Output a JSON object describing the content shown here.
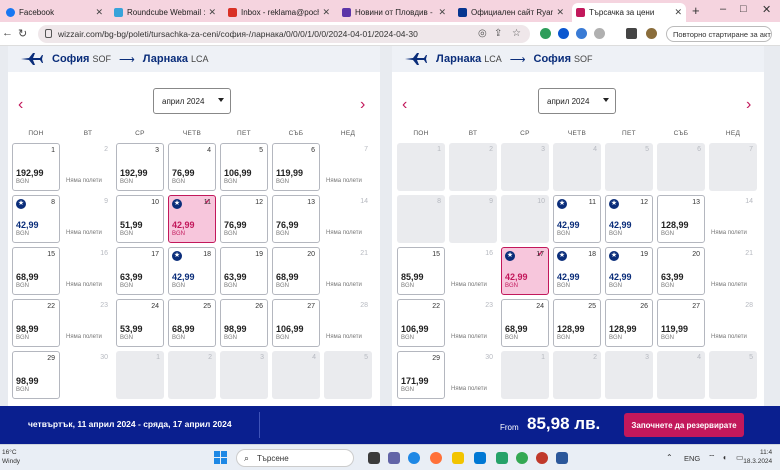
{
  "browser": {
    "tabs": [
      {
        "label": "Facebook",
        "color": "#1877f2"
      },
      {
        "label": "Roundcube Webmail :: Inb",
        "color": "#37a3da"
      },
      {
        "label": "Inbox - reklama@pochtepe",
        "color": "#d93025"
      },
      {
        "label": "Новини от Пловдив - Акт",
        "color": "#5c35a8"
      },
      {
        "label": "Официален сайт Ryanair",
        "color": "#073590"
      },
      {
        "label": "Търсачка за цени",
        "color": "#c2185b"
      }
    ],
    "url": "wizzair.com/bg-bg/poleti/tursachka-za-ceni/софия-/ларнака/0/0/0/1/0/0/2024-04-01/2024-04-30",
    "update_label": "Повторно стартиране за актуализиране"
  },
  "outbound": {
    "from_city": "София",
    "from_code": "SOF",
    "to_city": "Ларнака",
    "to_code": "LCA",
    "month": "април 2024",
    "weekdays": [
      "ПОН",
      "ВТ",
      "СР",
      "ЧЕТВ",
      "ПЕТ",
      "СЪБ",
      "НЕД"
    ],
    "cells": [
      {
        "day": "1",
        "price": "192,99",
        "cur": "BGN",
        "state": "flight"
      },
      {
        "day": "2",
        "state": "nf",
        "note": "Няма полети"
      },
      {
        "day": "3",
        "price": "192,99",
        "cur": "BGN",
        "state": "flight"
      },
      {
        "day": "4",
        "price": "76,99",
        "cur": "BGN",
        "state": "flight"
      },
      {
        "day": "5",
        "price": "106,99",
        "cur": "BGN",
        "state": "flight"
      },
      {
        "day": "6",
        "price": "119,99",
        "cur": "BGN",
        "state": "flight"
      },
      {
        "day": "7",
        "state": "nf",
        "note": "Няма полети"
      },
      {
        "day": "8",
        "price": "42,99",
        "cur": "BGN",
        "state": "star"
      },
      {
        "day": "9",
        "state": "nf",
        "note": "Няма полети"
      },
      {
        "day": "10",
        "price": "51,99",
        "cur": "BGN",
        "state": "flight"
      },
      {
        "day": "11",
        "price": "42,99",
        "cur": "BGN",
        "state": "selected"
      },
      {
        "day": "12",
        "price": "76,99",
        "cur": "BGN",
        "state": "flight"
      },
      {
        "day": "13",
        "price": "76,99",
        "cur": "BGN",
        "state": "flight"
      },
      {
        "day": "14",
        "state": "nf",
        "note": "Няма полети"
      },
      {
        "day": "15",
        "price": "68,99",
        "cur": "BGN",
        "state": "flight"
      },
      {
        "day": "16",
        "state": "nf",
        "note": "Няма полети"
      },
      {
        "day": "17",
        "price": "63,99",
        "cur": "BGN",
        "state": "flight"
      },
      {
        "day": "18",
        "price": "42,99",
        "cur": "BGN",
        "state": "star"
      },
      {
        "day": "19",
        "price": "63,99",
        "cur": "BGN",
        "state": "flight"
      },
      {
        "day": "20",
        "price": "68,99",
        "cur": "BGN",
        "state": "flight"
      },
      {
        "day": "21",
        "state": "nf",
        "note": "Няма полети"
      },
      {
        "day": "22",
        "price": "98,99",
        "cur": "BGN",
        "state": "flight"
      },
      {
        "day": "23",
        "state": "nf",
        "note": "Няма полети"
      },
      {
        "day": "24",
        "price": "53,99",
        "cur": "BGN",
        "state": "flight"
      },
      {
        "day": "25",
        "price": "68,99",
        "cur": "BGN",
        "state": "flight"
      },
      {
        "day": "26",
        "price": "98,99",
        "cur": "BGN",
        "state": "flight"
      },
      {
        "day": "27",
        "price": "106,99",
        "cur": "BGN",
        "state": "flight"
      },
      {
        "day": "28",
        "state": "nf",
        "note": "Няма полети"
      },
      {
        "day": "29",
        "price": "98,99",
        "cur": "BGN",
        "state": "flight"
      },
      {
        "day": "30",
        "state": "nf",
        "note": ""
      },
      {
        "day": "1",
        "state": "empty"
      },
      {
        "day": "2",
        "state": "empty"
      },
      {
        "day": "3",
        "state": "empty"
      },
      {
        "day": "4",
        "state": "empty"
      },
      {
        "day": "5",
        "state": "empty"
      }
    ]
  },
  "inbound": {
    "from_city": "Ларнака",
    "from_code": "LCA",
    "to_city": "София",
    "to_code": "SOF",
    "month": "април 2024",
    "weekdays": [
      "ПОН",
      "ВТ",
      "СР",
      "ЧЕТВ",
      "ПЕТ",
      "СЪБ",
      "НЕД"
    ],
    "cells": [
      {
        "day": "1",
        "state": "empty"
      },
      {
        "day": "2",
        "state": "empty"
      },
      {
        "day": "3",
        "state": "empty"
      },
      {
        "day": "4",
        "state": "empty"
      },
      {
        "day": "5",
        "state": "empty"
      },
      {
        "day": "6",
        "state": "empty"
      },
      {
        "day": "7",
        "state": "empty"
      },
      {
        "day": "8",
        "state": "empty"
      },
      {
        "day": "9",
        "state": "empty"
      },
      {
        "day": "10",
        "state": "empty"
      },
      {
        "day": "11",
        "price": "42,99",
        "cur": "BGN",
        "state": "star"
      },
      {
        "day": "12",
        "price": "42,99",
        "cur": "BGN",
        "state": "star"
      },
      {
        "day": "13",
        "price": "128,99",
        "cur": "BGN",
        "state": "flight"
      },
      {
        "day": "14",
        "state": "nf",
        "note": "Няма полети"
      },
      {
        "day": "15",
        "price": "85,99",
        "cur": "BGN",
        "state": "flight"
      },
      {
        "day": "16",
        "state": "nf",
        "note": "Няма полети"
      },
      {
        "day": "17",
        "price": "42,99",
        "cur": "BGN",
        "state": "selected"
      },
      {
        "day": "18",
        "price": "42,99",
        "cur": "BGN",
        "state": "star"
      },
      {
        "day": "19",
        "price": "42,99",
        "cur": "BGN",
        "state": "star"
      },
      {
        "day": "20",
        "price": "63,99",
        "cur": "BGN",
        "state": "flight"
      },
      {
        "day": "21",
        "state": "nf",
        "note": "Няма полети"
      },
      {
        "day": "22",
        "price": "106,99",
        "cur": "BGN",
        "state": "flight"
      },
      {
        "day": "23",
        "state": "nf",
        "note": "Няма полети"
      },
      {
        "day": "24",
        "price": "68,99",
        "cur": "BGN",
        "state": "flight"
      },
      {
        "day": "25",
        "price": "128,99",
        "cur": "BGN",
        "state": "flight"
      },
      {
        "day": "26",
        "price": "128,99",
        "cur": "BGN",
        "state": "flight"
      },
      {
        "day": "27",
        "price": "119,99",
        "cur": "BGN",
        "state": "flight"
      },
      {
        "day": "28",
        "state": "nf",
        "note": "Няма полети"
      },
      {
        "day": "29",
        "price": "171,99",
        "cur": "BGN",
        "state": "flight"
      },
      {
        "day": "30",
        "state": "nf",
        "note": "Няма полети"
      },
      {
        "day": "1",
        "state": "empty"
      },
      {
        "day": "2",
        "state": "empty"
      },
      {
        "day": "3",
        "state": "empty"
      },
      {
        "day": "4",
        "state": "empty"
      },
      {
        "day": "5",
        "state": "empty"
      }
    ]
  },
  "booking": {
    "dates": "четвъртък, 11 април 2024 - сряда, 17 април 2024",
    "from_label": "From",
    "price": "85,98 лв.",
    "cta": "Започнете да резервирате"
  },
  "taskbar": {
    "temp": "16°C",
    "weather": "Windy",
    "search": "Търсене",
    "lang": "ENG",
    "time": "11:4",
    "date": "18.3.2024"
  }
}
